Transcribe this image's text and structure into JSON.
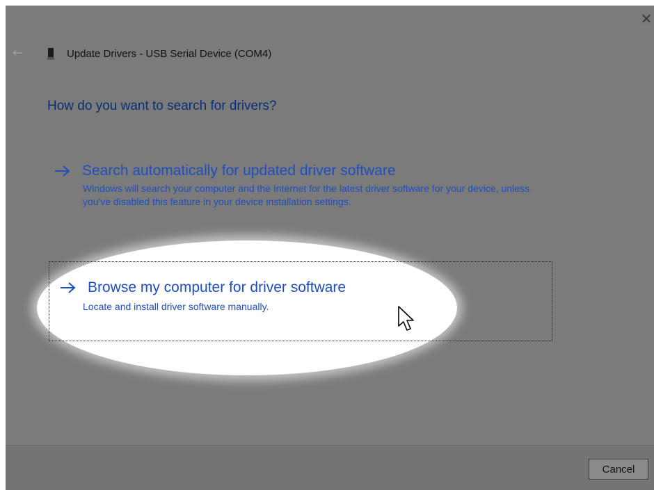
{
  "window": {
    "title": "Update Drivers - USB Serial Device (COM4)",
    "close_glyph": "✕",
    "back_glyph": "←",
    "device_icon": "usb-device-icon"
  },
  "prompt": {
    "question": "How do you want to search for drivers?"
  },
  "options": [
    {
      "title": "Search automatically for updated driver software",
      "description": "Windows will search your computer and the Internet for the latest driver software for your device, unless you've disabled this feature in your device installation settings.",
      "icon": "arrow-right-icon",
      "highlighted": false
    },
    {
      "title": "Browse my computer for driver software",
      "description": "Locate and install driver software manually.",
      "icon": "arrow-right-icon",
      "highlighted": true
    }
  ],
  "footer": {
    "cancel_label": "Cancel"
  },
  "colors": {
    "link": "#1f4ebd",
    "heading": "#0b2f75",
    "dim_overlay": "#7b7b7b",
    "spotlight": "#ffffff"
  }
}
